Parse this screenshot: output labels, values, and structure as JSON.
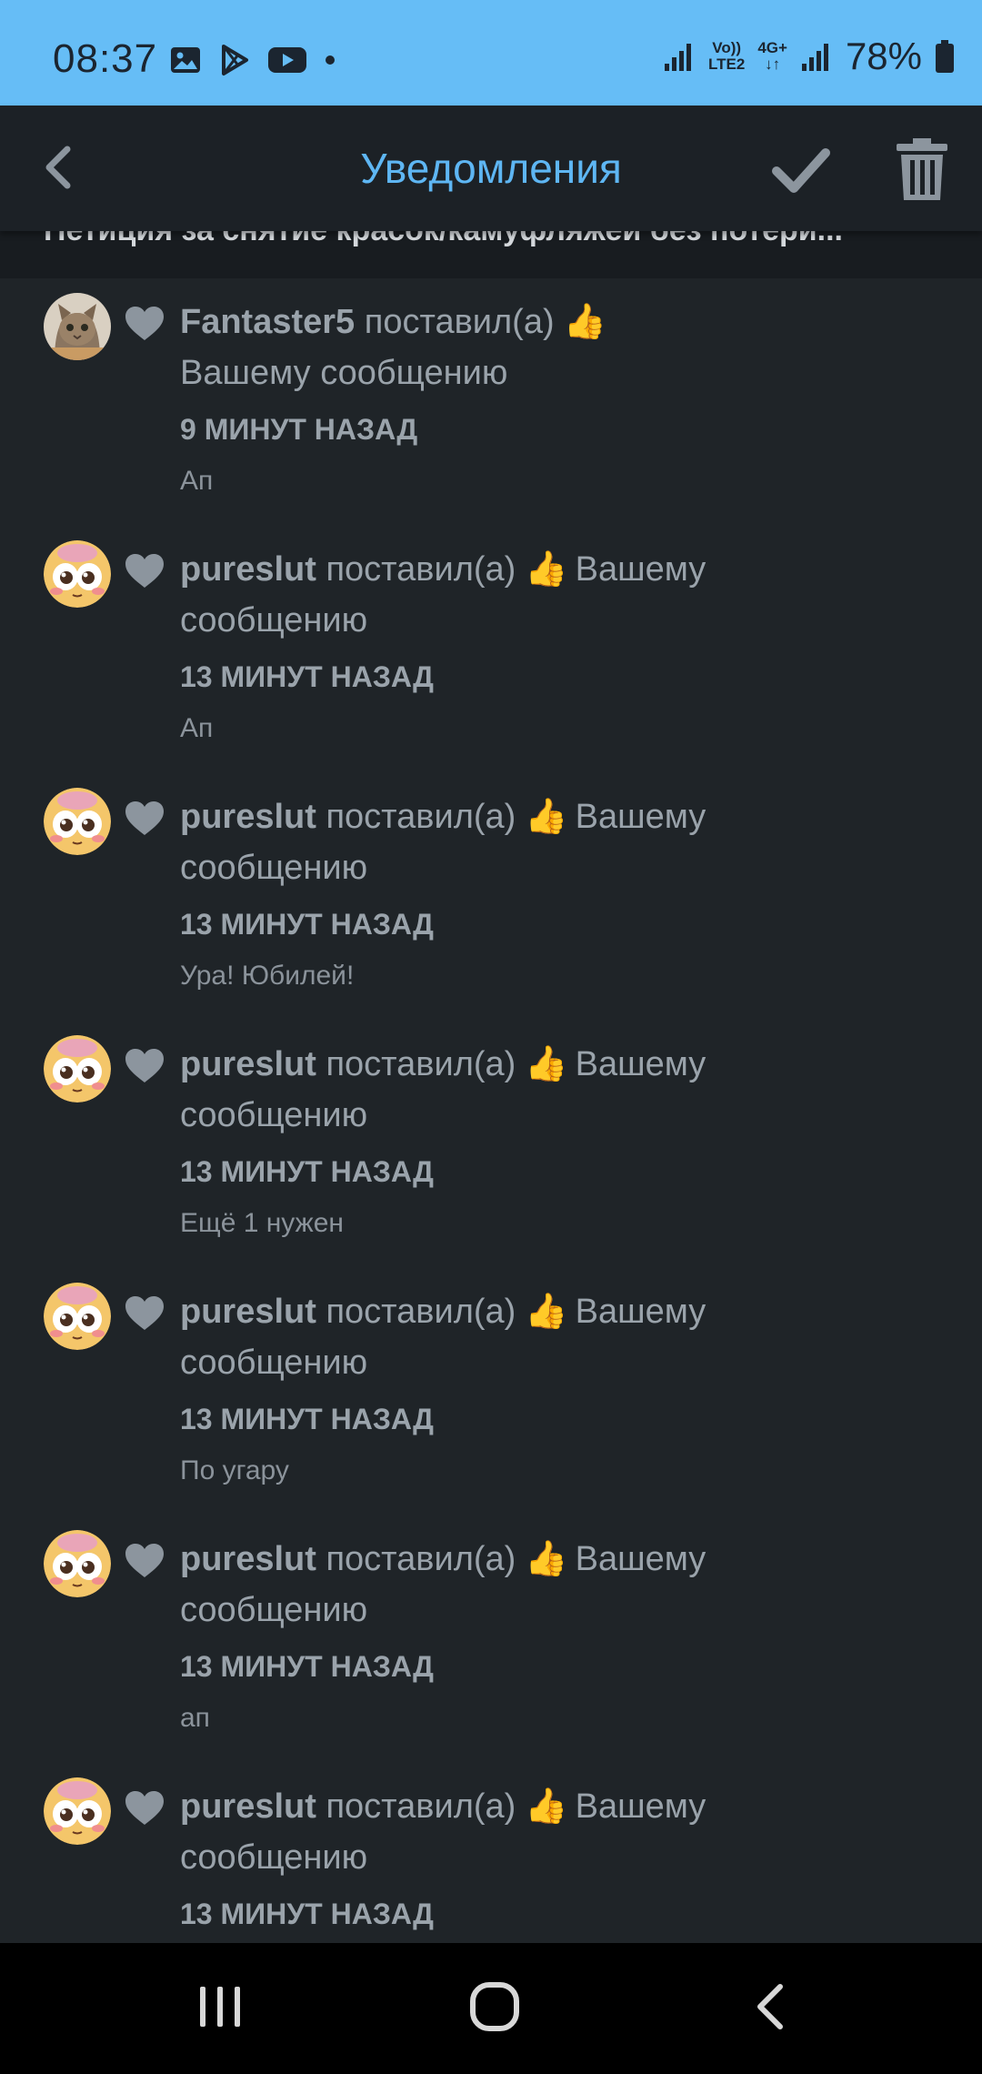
{
  "status_bar": {
    "time": "08:37",
    "net_line1": "Vo)) ",
    "net_line2": "LTE2",
    "net_4g": "4G+",
    "battery": "78%"
  },
  "app_bar": {
    "title": "Уведомления"
  },
  "thread_header": "Петиция за снятие красок/камуфляжей без потери...",
  "notifications": [
    {
      "user": "Fantaster5",
      "action": "поставил(а)",
      "thumb": "👍",
      "suffix": "Вашему сообщению",
      "time": "9 МИНУТ НАЗАД",
      "message": "Ап",
      "avatar": "cat"
    },
    {
      "user": "pureslut",
      "action": "поставил(а)",
      "thumb": "👍",
      "suffix": "Вашему сообщению",
      "time": "13 МИНУТ НАЗАД",
      "message": "Ап",
      "avatar": "face"
    },
    {
      "user": "pureslut",
      "action": "поставил(а)",
      "thumb": "👍",
      "suffix": "Вашему сообщению",
      "time": "13 МИНУТ НАЗАД",
      "message": "Ура! Юбилей!",
      "avatar": "face"
    },
    {
      "user": "pureslut",
      "action": "поставил(а)",
      "thumb": "👍",
      "suffix": "Вашему сообщению",
      "time": "13 МИНУТ НАЗАД",
      "message": "Ещё 1 нужен",
      "avatar": "face"
    },
    {
      "user": "pureslut",
      "action": "поставил(а)",
      "thumb": "👍",
      "suffix": "Вашему сообщению",
      "time": "13 МИНУТ НАЗАД",
      "message": "По угару",
      "avatar": "face"
    },
    {
      "user": "pureslut",
      "action": "поставил(а)",
      "thumb": "👍",
      "suffix": "Вашему сообщению",
      "time": "13 МИНУТ НАЗАД",
      "message": "ап",
      "avatar": "face"
    },
    {
      "user": "pureslut",
      "action": "поставил(а)",
      "thumb": "👍",
      "suffix": "Вашему сообщению",
      "time": "13 МИНУТ НАЗАД",
      "message": "",
      "avatar": "face"
    }
  ],
  "colors": {
    "accent": "#5eb6f3",
    "status_bar": "#66bdf6",
    "background": "#1f2428",
    "text_muted": "#9aa3ab"
  }
}
